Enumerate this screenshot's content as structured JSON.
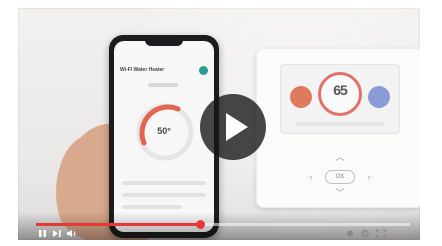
{
  "player": {
    "progress": 0.44,
    "accent_color": "#e53935",
    "controls": {
      "left": [
        "play-pause-icon",
        "next-icon",
        "volume-icon"
      ],
      "right": [
        "settings-dot-icon",
        "settings-gear-icon",
        "fullscreen-icon"
      ]
    }
  },
  "phone_app": {
    "title": "Wi-Fi Water Heater",
    "dial_value": "50°"
  },
  "thermostat": {
    "temperature": "65",
    "center_button": "OK"
  },
  "overlay": {
    "play_icon": "play-icon"
  }
}
